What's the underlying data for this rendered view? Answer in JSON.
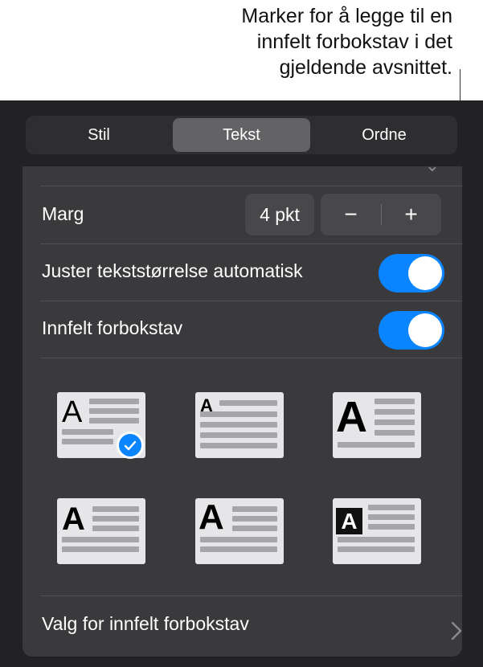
{
  "callout": {
    "line1": "Marker for å legge til en",
    "line2": "innfelt forbokstav i det",
    "line3": "gjeldende avsnittet."
  },
  "tabs": [
    {
      "label": "Stil",
      "selected": false
    },
    {
      "label": "Tekst",
      "selected": true
    },
    {
      "label": "Ordne",
      "selected": false
    }
  ],
  "margin": {
    "label": "Marg",
    "value": "4 pkt",
    "minus": "−",
    "plus": "+"
  },
  "auto_size": {
    "label": "Juster tekststørrelse automatisk",
    "on": true
  },
  "drop_cap": {
    "label": "Innfelt forbokstav",
    "on": true
  },
  "styles": {
    "letter": "A",
    "selected_index": 0
  },
  "options": {
    "label": "Valg for innfelt forbokstav"
  },
  "colors": {
    "accent": "#0a84ff",
    "panel": "#3a3a3c",
    "background": "#222224"
  }
}
